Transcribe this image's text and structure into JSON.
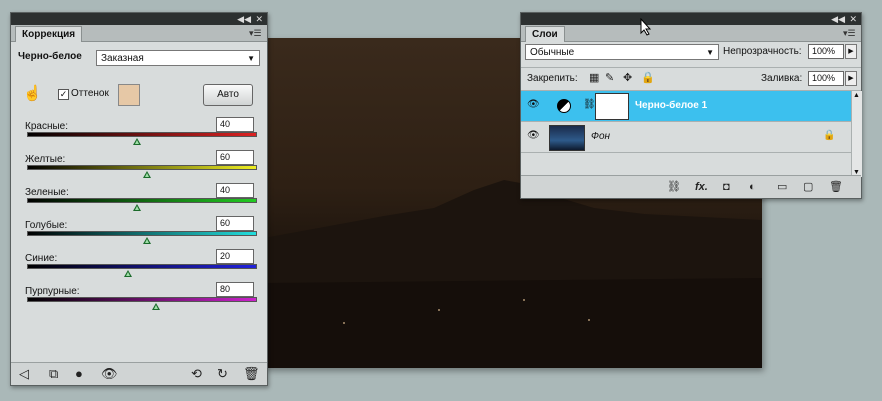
{
  "correction": {
    "tab": "Коррекция",
    "preset_label": "Черно-белое",
    "preset_value": "Заказная",
    "tint_label": "Оттенок",
    "auto_label": "Авто",
    "tint_color": "#e6c8a6",
    "sliders": [
      {
        "label": "Красные:",
        "value": "40",
        "level": 0.48,
        "grad": "linear-gradient(90deg,#000,#d22)"
      },
      {
        "label": "Желтые:",
        "value": "60",
        "level": 0.52,
        "grad": "linear-gradient(90deg,#000,#ee2)"
      },
      {
        "label": "Зеленые:",
        "value": "40",
        "level": 0.48,
        "grad": "linear-gradient(90deg,#000,#2c2)"
      },
      {
        "label": "Голубые:",
        "value": "60",
        "level": 0.52,
        "grad": "linear-gradient(90deg,#000,#2dd)"
      },
      {
        "label": "Синие:",
        "value": "20",
        "level": 0.44,
        "grad": "linear-gradient(90deg,#000,#22d)"
      },
      {
        "label": "Пурпурные:",
        "value": "80",
        "level": 0.56,
        "grad": "linear-gradient(90deg,#000,#c2c)"
      }
    ]
  },
  "layers": {
    "tab": "Слои",
    "blend_mode": "Обычные",
    "opacity_label": "Непрозрачность:",
    "opacity_value": "100%",
    "lock_label": "Закрепить:",
    "fill_label": "Заливка:",
    "fill_value": "100%",
    "items": [
      {
        "name": "Черно-белое 1",
        "selected": true
      },
      {
        "name": "Фон",
        "selected": false
      }
    ],
    "selection_color": "#3cc0ee",
    "fx_label": "fx."
  }
}
